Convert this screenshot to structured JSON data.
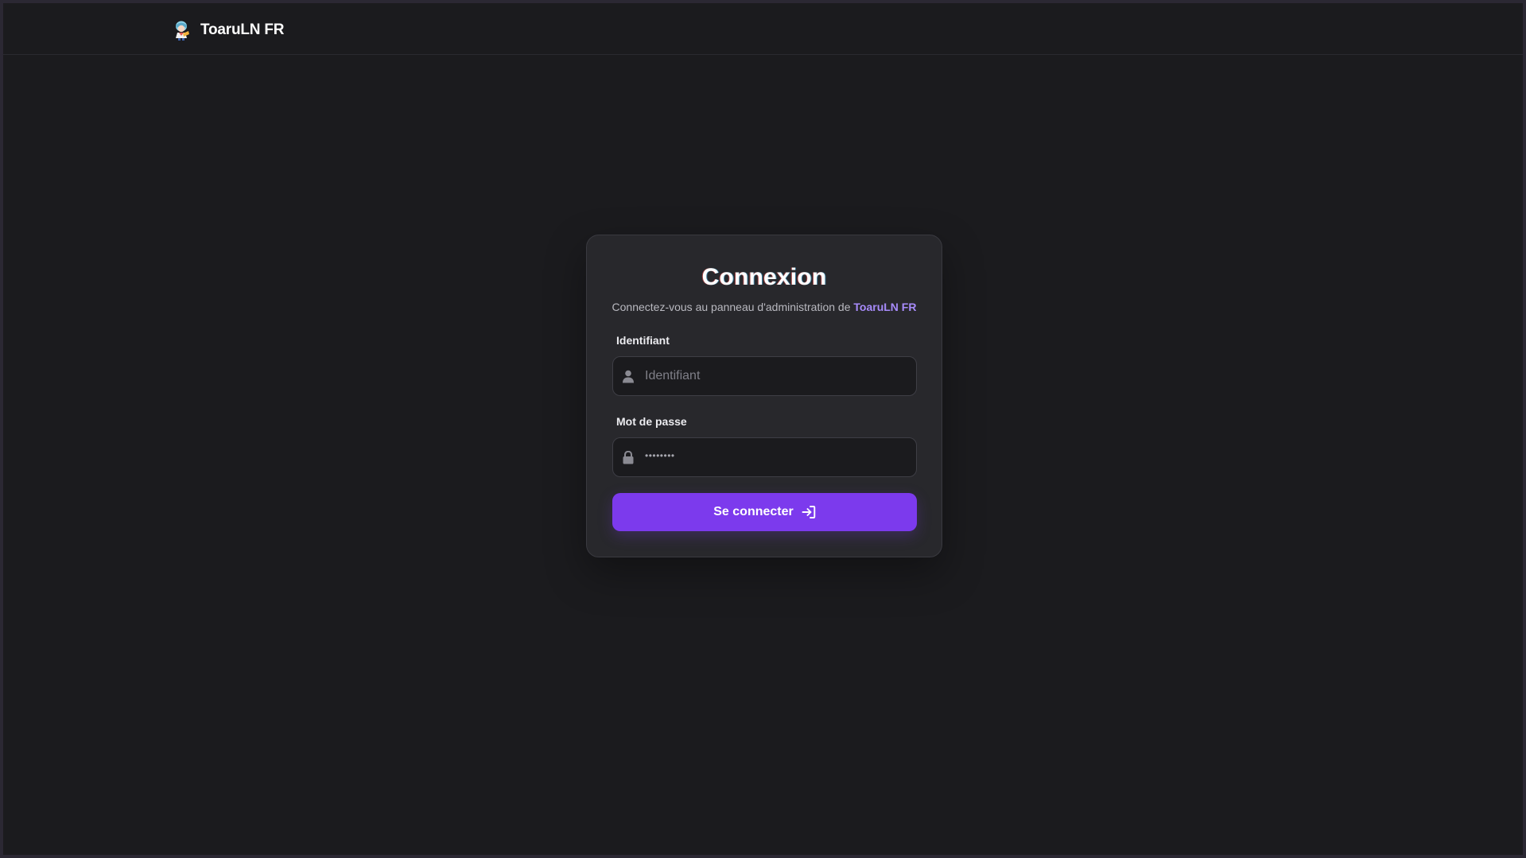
{
  "header": {
    "brand_name": "ToaruLN FR",
    "logo_icon": "anime-character-logo"
  },
  "login": {
    "title": "Connexion",
    "subtitle_prefix": "Connectez-vous au panneau d'administration de ",
    "subtitle_brand": "ToaruLN FR",
    "username_label": "Identifiant",
    "username_placeholder": "Identifiant",
    "username_value": "",
    "username_icon": "user-icon",
    "password_label": "Mot de passe",
    "password_value": "••••••••",
    "password_icon": "lock-icon",
    "submit_label": "Se connecter",
    "submit_icon": "login-arrow-icon"
  },
  "colors": {
    "background": "#1b1b1e",
    "card": "#28282c",
    "accent": "#7c3aed",
    "accent_text": "#a78bfa"
  }
}
